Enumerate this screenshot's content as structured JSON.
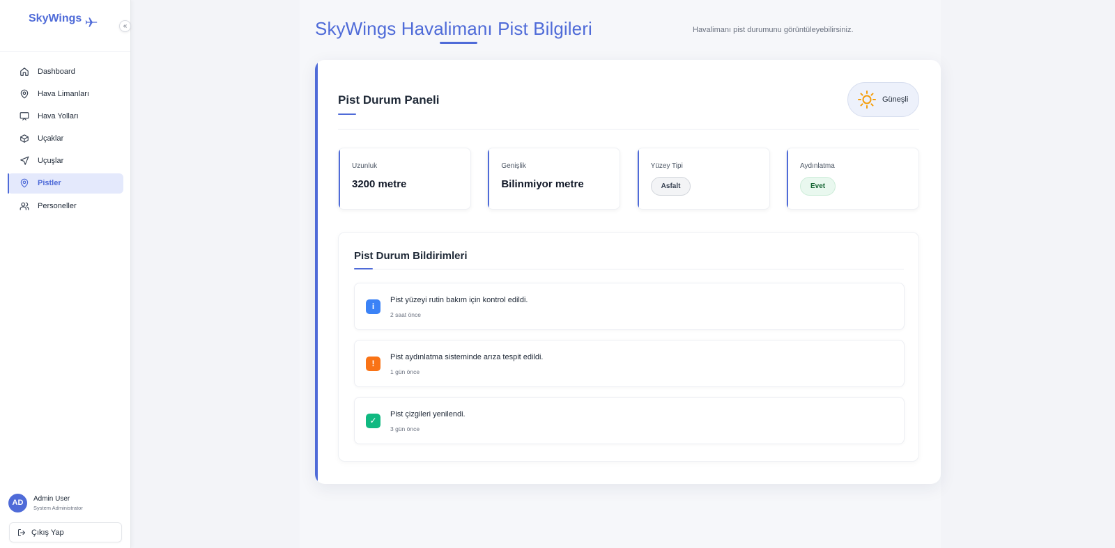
{
  "brand": {
    "name": "SkyWings",
    "collapse_glyph": "«"
  },
  "sidebar": {
    "items": [
      {
        "label": "Dashboard",
        "icon": "home-icon",
        "active": false
      },
      {
        "label": "Hava Limanları",
        "icon": "map-pin-icon",
        "active": false
      },
      {
        "label": "Hava Yolları",
        "icon": "monitor-icon",
        "active": false
      },
      {
        "label": "Uçaklar",
        "icon": "box-icon",
        "active": false
      },
      {
        "label": "Uçuşlar",
        "icon": "send-icon",
        "active": false
      },
      {
        "label": "Pistler",
        "icon": "map-pin-icon",
        "active": true
      },
      {
        "label": "Personeller",
        "icon": "users-icon",
        "active": false
      }
    ],
    "user": {
      "initials": "AD",
      "name": "Admin User",
      "role": "System Administrator"
    },
    "logout_label": "Çıkış Yap"
  },
  "header": {
    "title": "SkyWings Havalimanı Pist Bilgileri",
    "subtitle": "Havalimanı pist durumunu görüntüleyebilirsiniz."
  },
  "panel": {
    "title": "Pist Durum Paneli",
    "weather": {
      "label": "Güneşli",
      "icon": "sun-icon"
    },
    "stats": {
      "length": {
        "label": "Uzunluk",
        "value": "3200 metre"
      },
      "width": {
        "label": "Genişlik",
        "value": "Bilinmiyor metre"
      },
      "surface": {
        "label": "Yüzey Tipi",
        "value": "Asfalt"
      },
      "lighting": {
        "label": "Aydınlatma",
        "value": "Evet"
      }
    }
  },
  "notifications": {
    "title": "Pist Durum Bildirimleri",
    "items": [
      {
        "text": "Pist yüzeyi rutin bakım için kontrol edildi.",
        "time": "2 saat önce",
        "glyph": "i",
        "color": "#3b82f6"
      },
      {
        "text": "Pist aydınlatma sisteminde arıza tespit edildi.",
        "time": "1 gün önce",
        "glyph": "!",
        "color": "#f97316"
      },
      {
        "text": "Pist çizgileri yenilendi.",
        "time": "3 gün önce",
        "glyph": "✓",
        "color": "#10b981"
      }
    ]
  },
  "colors": {
    "accent": "#4f6bd8",
    "info": "#3b82f6",
    "warning": "#f97316",
    "success": "#10b981",
    "sun": "#f59e0b"
  }
}
